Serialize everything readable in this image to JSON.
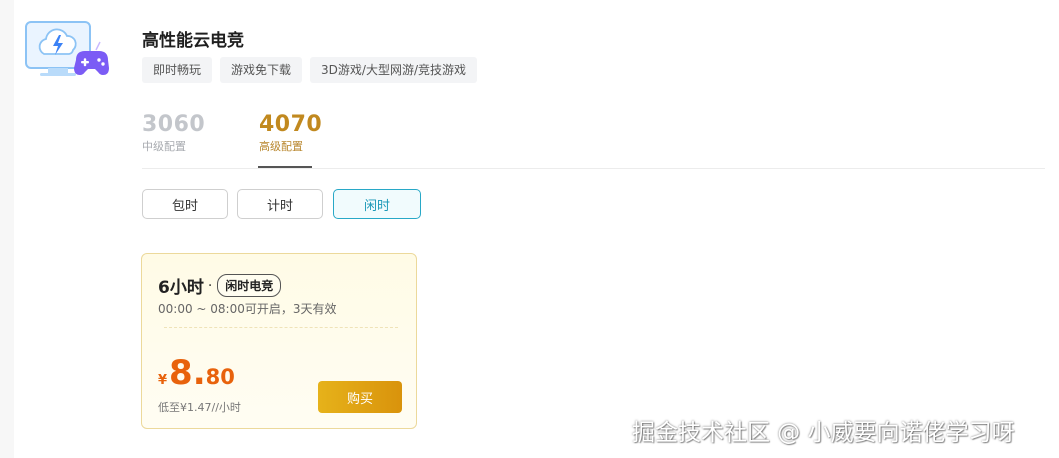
{
  "product": {
    "title": "高性能云电竞",
    "tags": [
      "即时畅玩",
      "游戏免下载",
      "3D游戏/大型网游/竞技游戏"
    ]
  },
  "config_tabs": [
    {
      "number": "3060",
      "label": "中级配置",
      "selected": false
    },
    {
      "number": "4070",
      "label": "高级配置",
      "selected": true
    }
  ],
  "billing_modes": {
    "bao": "包时",
    "ji": "计时",
    "xian": "闲时",
    "selected": "闲时"
  },
  "card": {
    "duration": "6小时",
    "separator": "·",
    "badge": "闲时电竞",
    "desc": "00:00 ~ 08:00可开启，3天有效",
    "currency": "¥",
    "price_int": "8.",
    "price_dec": "80",
    "note": "低至¥1.47//小时",
    "buy_label": "购买"
  },
  "watermark": "掘金技术社区 @ 小威要向诺佬学习呀",
  "colors": {
    "accent_gold": "#c1891f",
    "price_orange": "#e8620c",
    "selected_mode": "#28a8c7",
    "logo_blue": "#3b82f6",
    "logo_purple": "#7b5cf5"
  },
  "icons": [
    "cloud-gaming-logo-icon",
    "lightning-icon",
    "gamepad-icon"
  ]
}
